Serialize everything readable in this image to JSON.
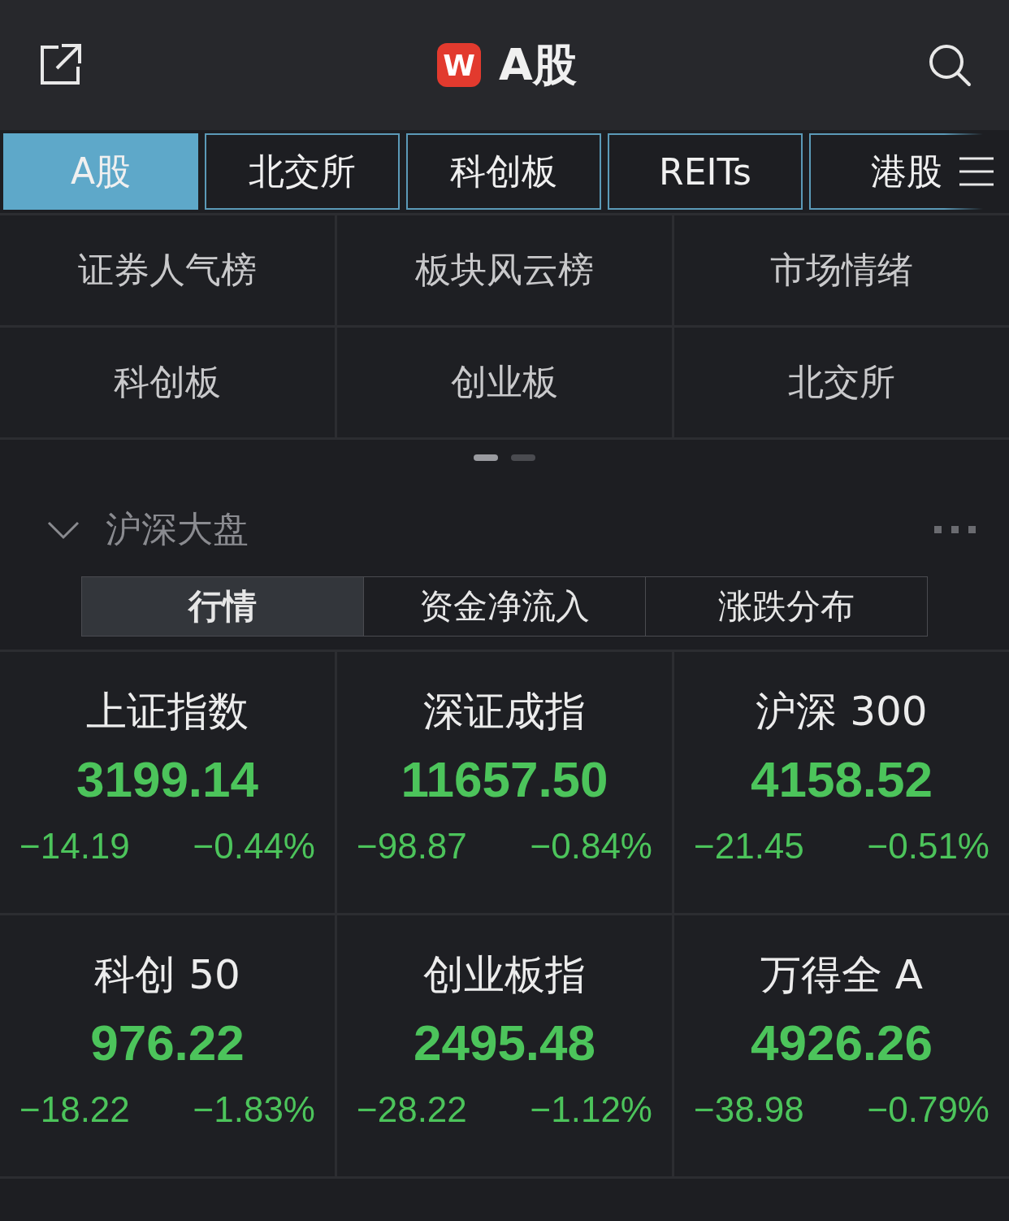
{
  "header": {
    "logo": "W",
    "title": "A股"
  },
  "tabs": [
    {
      "label": "A股",
      "selected": true
    },
    {
      "label": "北交所",
      "selected": false
    },
    {
      "label": "科创板",
      "selected": false
    },
    {
      "label": "REITs",
      "selected": false
    },
    {
      "label": "港股",
      "selected": false
    }
  ],
  "shortcuts": [
    "证券人气榜",
    "板块风云榜",
    "市场情绪",
    "科创板",
    "创业板",
    "北交所"
  ],
  "pager": [
    {
      "selected": true
    },
    {
      "selected": false
    }
  ],
  "section": {
    "title": "沪深大盘",
    "expanded": true
  },
  "segments": [
    {
      "label": "行情",
      "selected": true
    },
    {
      "label": "资金净流入",
      "selected": false
    },
    {
      "label": "涨跌分布",
      "selected": false
    }
  ],
  "indices": [
    {
      "name": "上证指数",
      "value": "3199.14",
      "change": "−14.19",
      "percent": "−0.44%"
    },
    {
      "name": "深证成指",
      "value": "11657.50",
      "change": "−98.87",
      "percent": "−0.84%"
    },
    {
      "name": "沪深 300",
      "value": "4158.52",
      "change": "−21.45",
      "percent": "−0.51%"
    },
    {
      "name": "科创 50",
      "value": "976.22",
      "change": "−18.22",
      "percent": "−1.83%"
    },
    {
      "name": "创业板指",
      "value": "2495.48",
      "change": "−28.22",
      "percent": "−1.12%"
    },
    {
      "name": "万得全 A",
      "value": "4926.26",
      "change": "−38.98",
      "percent": "−0.79%"
    }
  ]
}
